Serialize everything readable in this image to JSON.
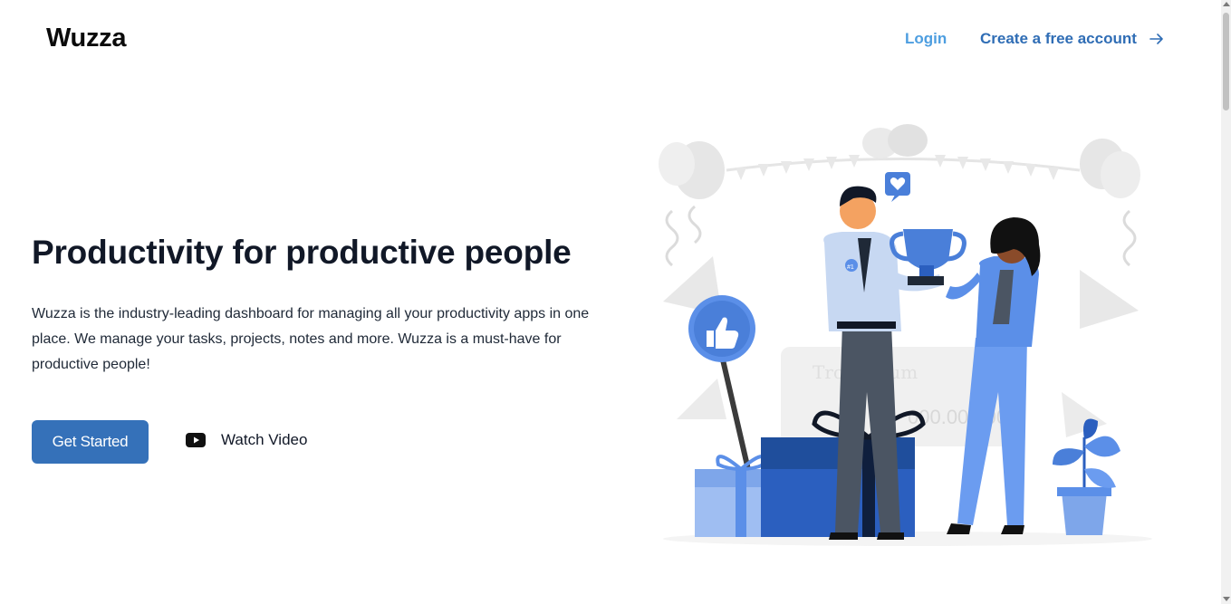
{
  "header": {
    "logo": "Wuzza",
    "login_label": "Login",
    "create_account_label": "Create a free account"
  },
  "hero": {
    "title": "Productivity for productive people",
    "description": "Wuzza is the industry-leading dashboard for managing all your productivity apps in one place. We manage your tasks, projects, notes and more. Wuzza is a must-have for productive people!",
    "primary_button": "Get Started",
    "video_button": "Watch Video",
    "illustration_trophy_text": "#1",
    "illustration_check_text": "000.000.00"
  },
  "colors": {
    "primary": "#3571b9",
    "link_light": "#4d9ee0",
    "link_dark": "#2f6db5",
    "illustration_blue": "#5b8fe8",
    "illustration_navy": "#1f4e9c"
  },
  "icons": {
    "arrow": "arrow-right-icon",
    "video": "youtube-play-icon",
    "like": "thumbs-up-icon",
    "heart": "heart-bubble-icon"
  }
}
